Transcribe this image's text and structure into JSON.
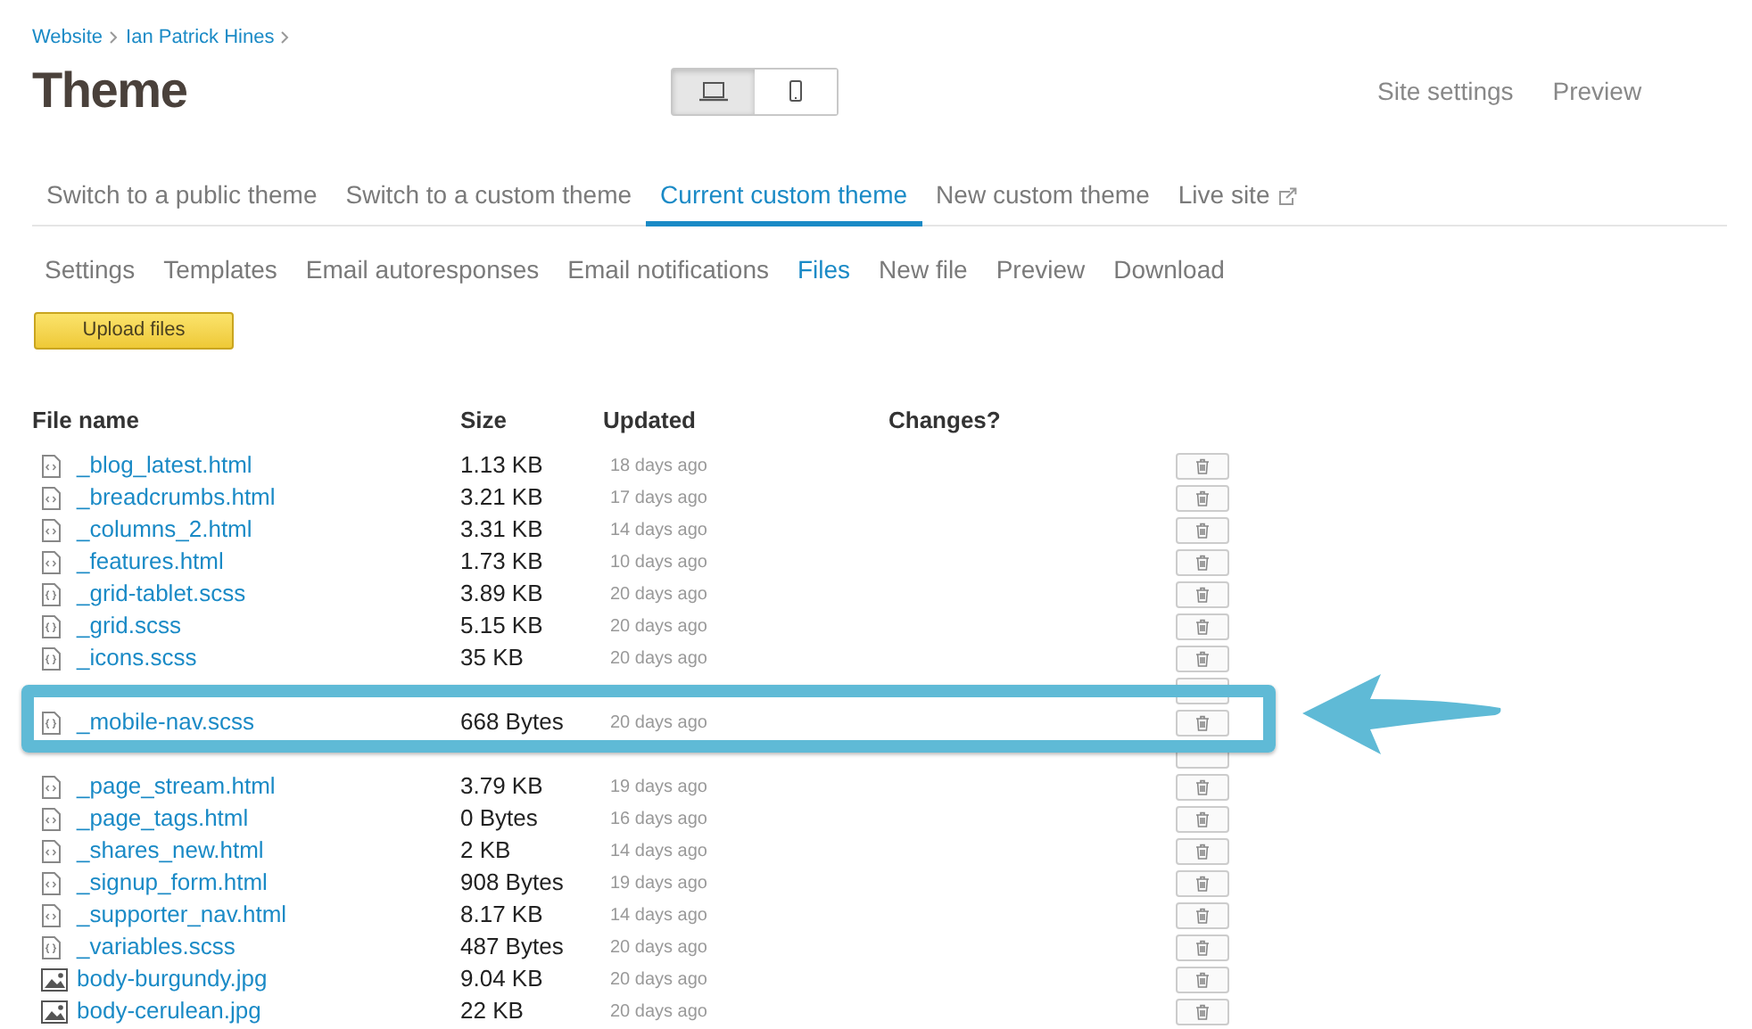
{
  "breadcrumbs": [
    "Website",
    "Ian Patrick Hines"
  ],
  "title": "Theme",
  "device_toggle": [
    {
      "kind": "desktop",
      "selected": true
    },
    {
      "kind": "mobile",
      "selected": false
    }
  ],
  "header_links": [
    "Site settings",
    "Preview"
  ],
  "tabs": [
    {
      "label": "Switch to a public theme",
      "selected": false
    },
    {
      "label": "Switch to a custom theme",
      "selected": false
    },
    {
      "label": "Current custom theme",
      "selected": true
    },
    {
      "label": "New custom theme",
      "selected": false
    },
    {
      "label": "Live site",
      "selected": false,
      "external": true
    }
  ],
  "subtabs": [
    {
      "label": "Settings",
      "selected": false
    },
    {
      "label": "Templates",
      "selected": false
    },
    {
      "label": "Email autoresponses",
      "selected": false
    },
    {
      "label": "Email notifications",
      "selected": false
    },
    {
      "label": "Files",
      "selected": true
    },
    {
      "label": "New file",
      "selected": false
    },
    {
      "label": "Preview",
      "selected": false
    },
    {
      "label": "Download",
      "selected": false
    }
  ],
  "upload_button": "Upload files",
  "table": {
    "columns": [
      "File name",
      "Size",
      "Updated",
      "Changes?"
    ],
    "rows": [
      {
        "kind": "html",
        "name": "_blog_latest.html",
        "size": "1.13 KB",
        "updated": "18 days ago"
      },
      {
        "kind": "html",
        "name": "_breadcrumbs.html",
        "size": "3.21 KB",
        "updated": "17 days ago"
      },
      {
        "kind": "html",
        "name": "_columns_2.html",
        "size": "3.31 KB",
        "updated": "14 days ago"
      },
      {
        "kind": "html",
        "name": "_features.html",
        "size": "1.73 KB",
        "updated": "10 days ago"
      },
      {
        "kind": "scss",
        "name": "_grid-tablet.scss",
        "size": "3.89 KB",
        "updated": "20 days ago"
      },
      {
        "kind": "scss",
        "name": "_grid.scss",
        "size": "5.15 KB",
        "updated": "20 days ago"
      },
      {
        "kind": "scss",
        "name": "_icons.scss",
        "size": "35 KB",
        "updated": "20 days ago"
      },
      {
        "kind": "hidden"
      },
      {
        "kind": "scss",
        "name": "_mobile-nav.scss",
        "size": "668 Bytes",
        "updated": "20 days ago",
        "highlighted": true
      },
      {
        "kind": "hidden"
      },
      {
        "kind": "html",
        "name": "_page_stream.html",
        "size": "3.79 KB",
        "updated": "19 days ago"
      },
      {
        "kind": "html",
        "name": "_page_tags.html",
        "size": "0 Bytes",
        "updated": "16 days ago"
      },
      {
        "kind": "html",
        "name": "_shares_new.html",
        "size": "2 KB",
        "updated": "14 days ago"
      },
      {
        "kind": "html",
        "name": "_signup_form.html",
        "size": "908 Bytes",
        "updated": "19 days ago"
      },
      {
        "kind": "html",
        "name": "_supporter_nav.html",
        "size": "8.17 KB",
        "updated": "14 days ago"
      },
      {
        "kind": "scss",
        "name": "_variables.scss",
        "size": "487 Bytes",
        "updated": "20 days ago"
      },
      {
        "kind": "image",
        "name": "body-burgundy.jpg",
        "size": "9.04 KB",
        "updated": "20 days ago"
      },
      {
        "kind": "image",
        "name": "body-cerulean.jpg",
        "size": "22 KB",
        "updated": "20 days ago"
      }
    ]
  }
}
